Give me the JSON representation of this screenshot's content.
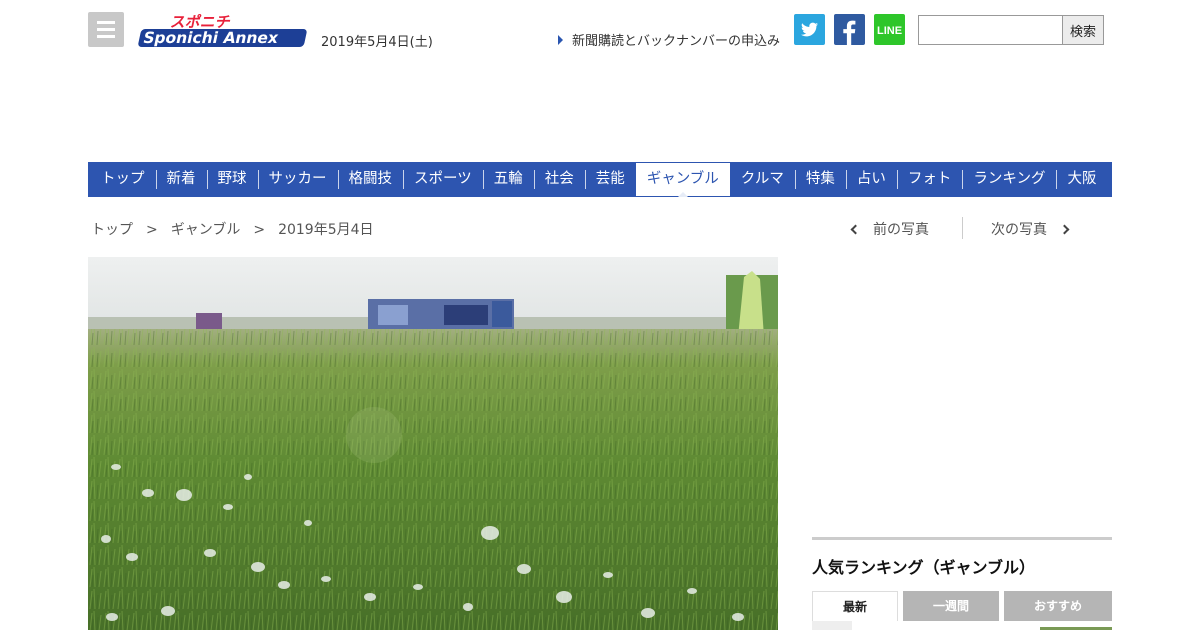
{
  "header": {
    "logo_top": "スポニチ",
    "logo_main": "Sponichi Annex",
    "date": "2019年5月4日(土)",
    "subscribe_link": "新聞購読とバックナンバーの申込み",
    "search_placeholder": "",
    "search_button": "検索",
    "sns": [
      {
        "name": "twitter",
        "color": "#2ba6df"
      },
      {
        "name": "facebook",
        "color": "#2f5aa0"
      },
      {
        "name": "line",
        "label": "LINE",
        "color": "#2ec62a"
      }
    ]
  },
  "nav": {
    "items": [
      {
        "label": "トップ",
        "active": false
      },
      {
        "label": "新着",
        "active": false
      },
      {
        "label": "野球",
        "active": false
      },
      {
        "label": "サッカー",
        "active": false
      },
      {
        "label": "格闘技",
        "active": false
      },
      {
        "label": "スポーツ",
        "active": false
      },
      {
        "label": "五輪",
        "active": false
      },
      {
        "label": "社会",
        "active": false
      },
      {
        "label": "芸能",
        "active": false
      },
      {
        "label": "ギャンブル",
        "active": true
      },
      {
        "label": "クルマ",
        "active": false
      },
      {
        "label": "特集",
        "active": false
      },
      {
        "label": "占い",
        "active": false
      },
      {
        "label": "フォト",
        "active": false
      },
      {
        "label": "ランキング",
        "active": false
      },
      {
        "label": "大阪",
        "active": false
      }
    ],
    "color": "#2d55b0"
  },
  "breadcrumb": {
    "items": [
      "トップ",
      "ギャンブル",
      "2019年5月4日"
    ],
    "separator": ">"
  },
  "photo_nav": {
    "prev": "前の写真",
    "next": "次の写真"
  },
  "ranking": {
    "title": "人気ランキング（ギャンブル）",
    "tabs": [
      "最新",
      "一週間",
      "おすすめ"
    ],
    "active_tab": "最新"
  }
}
